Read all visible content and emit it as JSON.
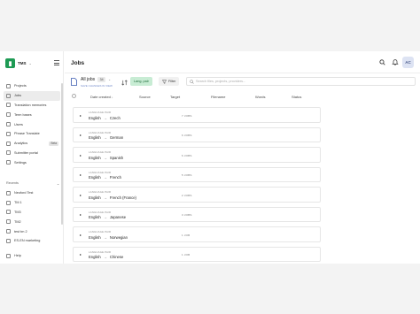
{
  "app": {
    "name": "TMS"
  },
  "sidebar": {
    "items": [
      {
        "label": "Projects",
        "active": false
      },
      {
        "label": "Jobs",
        "active": true
      },
      {
        "label": "Translation memories",
        "active": false
      },
      {
        "label": "Term bases",
        "active": false
      },
      {
        "label": "Users",
        "active": false
      },
      {
        "label": "Phrase Translate",
        "active": false
      },
      {
        "label": "Analytics",
        "active": false,
        "badge": "Beta"
      },
      {
        "label": "Submitter portal",
        "active": false
      },
      {
        "label": "Settings",
        "active": false
      }
    ],
    "recents_label": "Recents",
    "recents": [
      {
        "label": "Neuford Test"
      },
      {
        "label": "TM 1"
      },
      {
        "label": "TM3"
      },
      {
        "label": "TM2"
      },
      {
        "label": "test tm 2"
      },
      {
        "label": "ES-EN marketing"
      }
    ],
    "help_label": "Help"
  },
  "header": {
    "title": "Jobs",
    "avatar_initials": "AC"
  },
  "toolbar": {
    "view_title": "All jobs",
    "count": "34",
    "saved_note": "SAVE CHANGES IN VIEW",
    "chip_label": "Lang. pair",
    "filter_label": "Filter",
    "search_placeholder": "Search files, projects, providers..."
  },
  "table": {
    "columns": [
      {
        "label": "Date created",
        "arrow": "↓"
      },
      {
        "label": "Source"
      },
      {
        "label": "Target"
      },
      {
        "label": "Filename"
      },
      {
        "label": "Words"
      },
      {
        "label": "Status"
      }
    ],
    "caption": "LANGUAGE PAIR",
    "rows": [
      {
        "source": "English",
        "target": "Czech",
        "jobs": "7 JOBS"
      },
      {
        "source": "English",
        "target": "German",
        "jobs": "6 JOBS"
      },
      {
        "source": "English",
        "target": "Spanish",
        "jobs": "6 JOBS"
      },
      {
        "source": "English",
        "target": "French",
        "jobs": "5 JOBS"
      },
      {
        "source": "English",
        "target": "French (France)",
        "jobs": "2 JOBS"
      },
      {
        "source": "English",
        "target": "Japanese",
        "jobs": "3 JOBS"
      },
      {
        "source": "English",
        "target": "Norwegian",
        "jobs": "1 JOB"
      },
      {
        "source": "English",
        "target": "Chinese",
        "jobs": "1 JOB"
      }
    ]
  },
  "colors": {
    "accent": "#1e9a54",
    "chip_bg": "#c8ecd4",
    "link": "#7289c9"
  }
}
